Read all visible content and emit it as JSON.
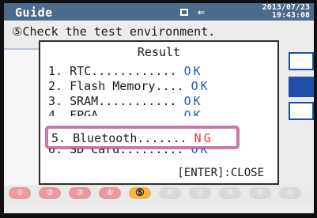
{
  "header": {
    "title": "Guide",
    "date": "2013/07/23",
    "time": "19:43:08",
    "battery_icon": "battery-icon",
    "power_icon": "plug-icon"
  },
  "instruction": "⑤Check the test environment.",
  "dialog": {
    "title": "Result",
    "rows": [
      {
        "label": "1. RTC............",
        "result": "OK"
      },
      {
        "label": "2. Flash Memory....",
        "result": "OK"
      },
      {
        "label": "3. SRAM...........",
        "result": "OK"
      },
      {
        "label": "4. FPGA...........",
        "result": "OK"
      },
      {
        "label": "5. Bluetooth.......",
        "result": "NG"
      },
      {
        "label": "6. SD Card.........",
        "result": "OK"
      }
    ],
    "close_label": "[ENTER]:CLOSE"
  },
  "steps": [
    "①",
    "②",
    "③",
    "④",
    "⑤",
    "⑥",
    "⑦",
    "⑧",
    "⑨",
    "⑩"
  ],
  "colors": {
    "titlebar": "#4a6b8a",
    "ok": "#1d56c8",
    "ng": "#e23a2a",
    "highlight_border": "#c77aa6"
  }
}
